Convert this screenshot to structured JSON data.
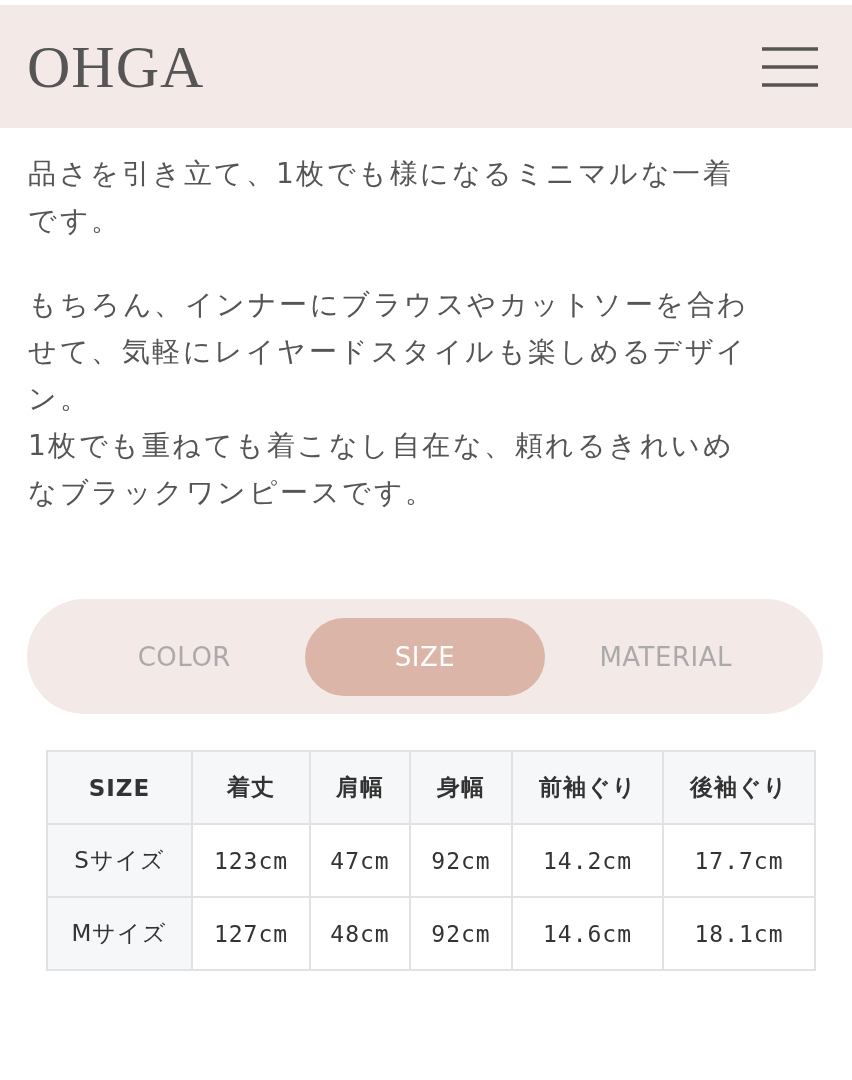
{
  "header": {
    "logo": "OHGA"
  },
  "description": [
    {
      "lines": [
        "品さを引き立て、1枚でも様になるミニマルな一着",
        "です。"
      ]
    },
    {
      "lines": [
        "もちろん、インナーにブラウスやカットソーを合わ",
        "せて、気軽にレイヤードスタイルも楽しめるデザイ",
        "ン。",
        "1枚でも重ねても着こなし自在な、頼れるきれいめ",
        "なブラックワンピースです。"
      ]
    }
  ],
  "tabs": [
    {
      "label": "COLOR",
      "selected": false
    },
    {
      "label": "SIZE",
      "selected": true
    },
    {
      "label": "MATERIAL",
      "selected": false
    }
  ],
  "size_table": {
    "columns": [
      "SIZE",
      "着丈",
      "肩幅",
      "身幅",
      "前袖ぐり",
      "後袖ぐり"
    ],
    "rows": [
      [
        "Sサイズ",
        "123cm",
        "47cm",
        "92cm",
        "14.2cm",
        "17.7cm"
      ],
      [
        "Mサイズ",
        "127cm",
        "48cm",
        "92cm",
        "14.6cm",
        "18.1cm"
      ]
    ]
  }
}
